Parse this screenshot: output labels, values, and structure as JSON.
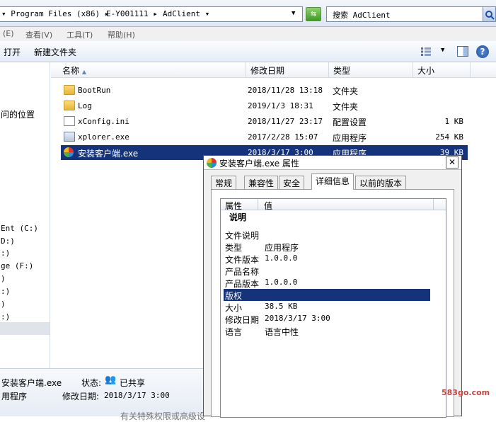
{
  "address": {
    "crumbs": [
      "▾ Program Files (x86) ▸",
      "E-Y001111 ▸",
      "AdClient ▾"
    ],
    "search_placeholder": "搜索 AdClient"
  },
  "menu": [
    "(E)",
    "查看(V)",
    "工具(T)",
    "帮助(H)"
  ],
  "toolbar": {
    "open": "打开",
    "new_folder": "新建文件夹"
  },
  "nav": [
    {
      "label": "问的位置"
    },
    {
      "label": "Ent (C:)"
    },
    {
      "label": "D:)"
    },
    {
      "label": ":)"
    },
    {
      "label": "ge (F:)"
    },
    {
      "label": ")"
    },
    {
      "label": ":)"
    },
    {
      "label": ")"
    },
    {
      "label": ":)"
    }
  ],
  "columns": {
    "name": "名称",
    "date": "修改日期",
    "type": "类型",
    "size": "大小"
  },
  "files": [
    {
      "name": "BootRun",
      "date": "2018/11/28 13:18",
      "type": "文件夹",
      "size": "",
      "icon": "folder"
    },
    {
      "name": "Log",
      "date": "2019/1/3 18:31",
      "type": "文件夹",
      "size": "",
      "icon": "folder"
    },
    {
      "name": "xConfig.ini",
      "date": "2018/11/27 23:17",
      "type": "配置设置",
      "size": "1 KB",
      "icon": "config"
    },
    {
      "name": "xplorer.exe",
      "date": "2017/2/28 15:07",
      "type": "应用程序",
      "size": "254 KB",
      "icon": "exe"
    },
    {
      "name": "安装客户端.exe",
      "date": "2018/3/17 3:00",
      "type": "应用程序",
      "size": "39 KB",
      "icon": "installer"
    }
  ],
  "details": {
    "filename": "安装客户端.exe",
    "type": "用程序",
    "state_label": "状态:",
    "state_value": "已共享",
    "modified_label": "修改日期:",
    "modified_value": "2018/3/17 3:00",
    "footer": "有关特殊权限或高级设"
  },
  "dialog": {
    "title": "安装客户端.exe 属性",
    "close": "✕",
    "tabs": [
      "常规",
      "兼容性",
      "安全",
      "详细信息",
      "以前的版本"
    ],
    "active_tab": "详细信息",
    "header_prop": "属性",
    "header_val": "值",
    "section": "说明",
    "props": [
      {
        "k": "文件说明",
        "v": ""
      },
      {
        "k": "类型",
        "v": "应用程序"
      },
      {
        "k": "文件版本",
        "v": "1.0.0.0"
      },
      {
        "k": "产品名称",
        "v": ""
      },
      {
        "k": "产品版本",
        "v": "1.0.0.0"
      },
      {
        "k": "版权",
        "v": ""
      },
      {
        "k": "大小",
        "v": "38.5 KB"
      },
      {
        "k": "修改日期",
        "v": "2018/3/17 3:00"
      },
      {
        "k": "语言",
        "v": "语言中性"
      }
    ],
    "selected_prop": "版权"
  },
  "watermark": "583go.com"
}
